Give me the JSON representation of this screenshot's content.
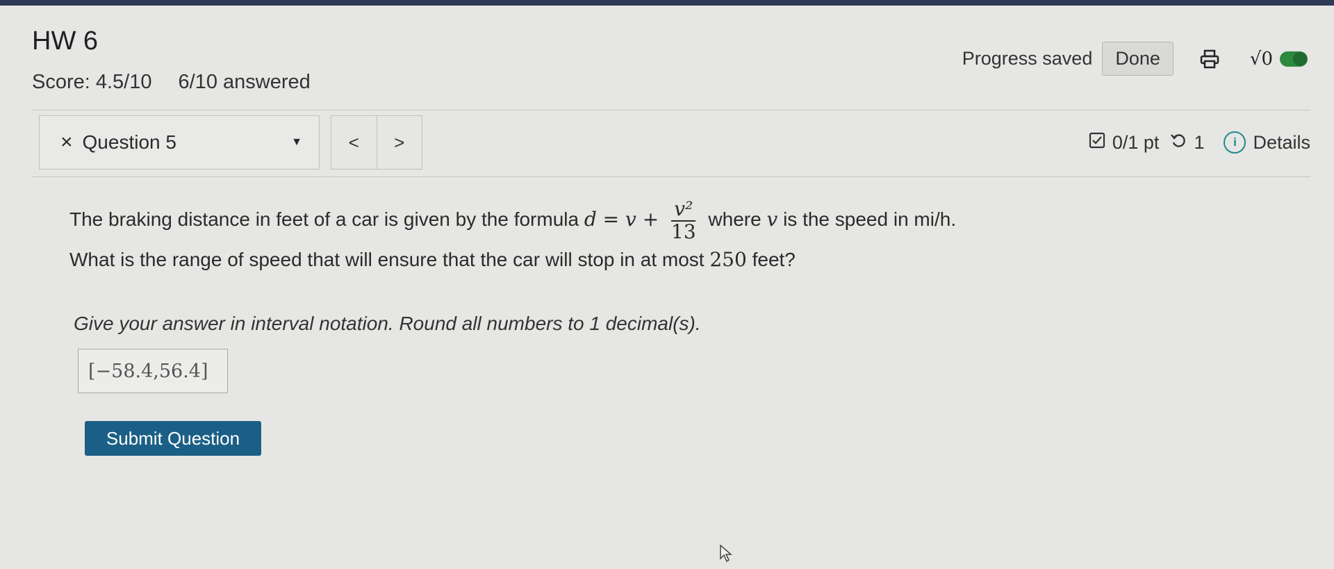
{
  "header": {
    "title": "HW 6",
    "score": "Score: 4.5/10",
    "answered": "6/10 answered",
    "progress_status": "Progress saved",
    "done_label": "Done",
    "print_icon": "printer-icon",
    "math_icon_label": "√0"
  },
  "question_nav": {
    "close_mark": "×",
    "question_label": "Question 5",
    "prev_label": "<",
    "next_label": ">",
    "points": "0/1 pt",
    "attempts": "1",
    "details_label": "Details"
  },
  "question": {
    "text_before": "The braking distance in feet of a car is given by the formula",
    "formula_lhs": "d = v +",
    "formula_num": "v²",
    "formula_den": "13",
    "text_after_1": "where",
    "var_v": "v",
    "text_after_2": "is the speed in mi/h. What is the range of speed that will ensure that the car will stop in at most",
    "max_distance": "250",
    "text_end": "feet?",
    "instructions": "Give your answer in interval notation. Round all numbers to 1 decimal(s).",
    "answer_value": "[−58.4,56.4]",
    "submit_label": "Submit Question"
  },
  "colors": {
    "submit_bg": "#1b5f86",
    "toggle_on": "#2b8a3e",
    "info_accent": "#1f8a8a"
  }
}
